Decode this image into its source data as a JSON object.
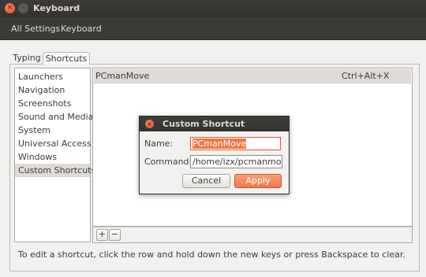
{
  "window": {
    "title": "Keyboard",
    "close_glyph": "×",
    "minimize_glyph": "–"
  },
  "toolbar": {
    "all_settings": "All Settings",
    "current": "Keyboard"
  },
  "tabs": [
    {
      "label": "Typing"
    },
    {
      "label": "Shortcuts"
    }
  ],
  "categories": [
    {
      "label": "Launchers"
    },
    {
      "label": "Navigation"
    },
    {
      "label": "Screenshots"
    },
    {
      "label": "Sound and Media"
    },
    {
      "label": "System"
    },
    {
      "label": "Universal Access"
    },
    {
      "label": "Windows"
    },
    {
      "label": "Custom Shortcuts"
    }
  ],
  "shortcuts": [
    {
      "name": "PCmanMove",
      "keys": "Ctrl+Alt+X"
    }
  ],
  "list_toolbar": {
    "add": "+",
    "remove": "−"
  },
  "hint": "To edit a shortcut, click the row and hold down the new keys or press Backspace to clear.",
  "dialog": {
    "title": "Custom Shortcut",
    "close_glyph": "×",
    "name_label": "Name:",
    "name_value": "PCmanMove",
    "command_label": "Command:",
    "command_value": "/home/izx/pcmanmov",
    "cancel": "Cancel",
    "apply": "Apply"
  }
}
